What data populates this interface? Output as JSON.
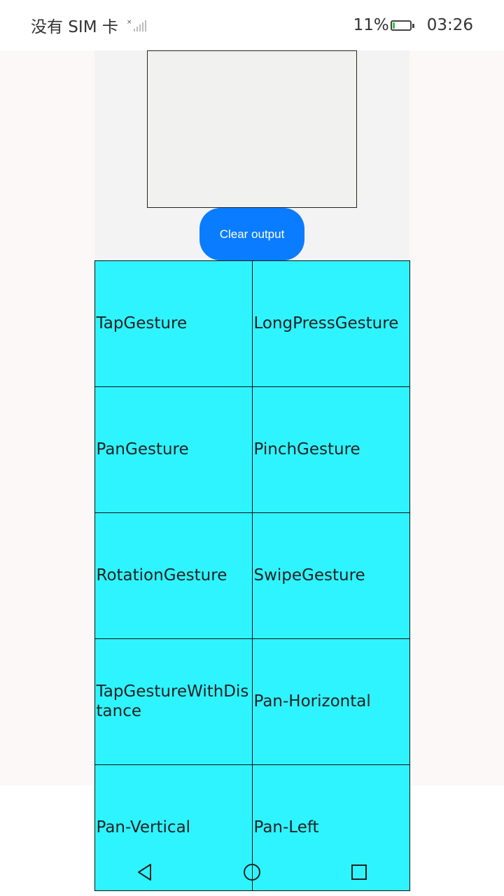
{
  "status_bar": {
    "carrier": "没有 SIM 卡",
    "battery_percent": "11%",
    "battery_level": 0.11,
    "time": "03:26",
    "icons": [
      "signal-icon",
      "battery-icon"
    ]
  },
  "output": {
    "text": ""
  },
  "clear_button": {
    "label": "Clear output"
  },
  "gesture_tests": [
    {
      "label": "TapGesture"
    },
    {
      "label": "LongPressGesture"
    },
    {
      "label": "PanGesture"
    },
    {
      "label": "PinchGesture"
    },
    {
      "label": "RotationGesture"
    },
    {
      "label": "SwipeGesture"
    },
    {
      "label": "TapGestureWithDistance"
    },
    {
      "label": "Pan-Horizontal"
    },
    {
      "label": "Pan-Vertical"
    },
    {
      "label": "Pan-Left"
    }
  ],
  "nav_bar": {
    "icons": [
      "back-icon",
      "home-icon",
      "recents-icon"
    ]
  },
  "colors": {
    "accent": "#0a7cff",
    "cell_background": "#2ef4ff",
    "battery_fill": "#3cc34a"
  }
}
